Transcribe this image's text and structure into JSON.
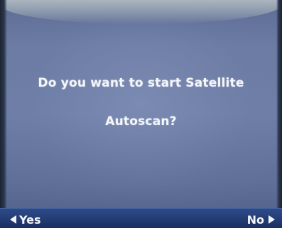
{
  "dialog": {
    "line1": "Do you want to start Satellite",
    "line2": "Autoscan?"
  },
  "softkeys": {
    "left_label": "Yes",
    "left_icon": "triangle-left-icon",
    "right_label": "No",
    "right_icon": "triangle-right-icon"
  },
  "colors": {
    "screen_bg": "#6b7ba2",
    "softkey_bar": "#233c75",
    "text": "#f4f6fa"
  }
}
